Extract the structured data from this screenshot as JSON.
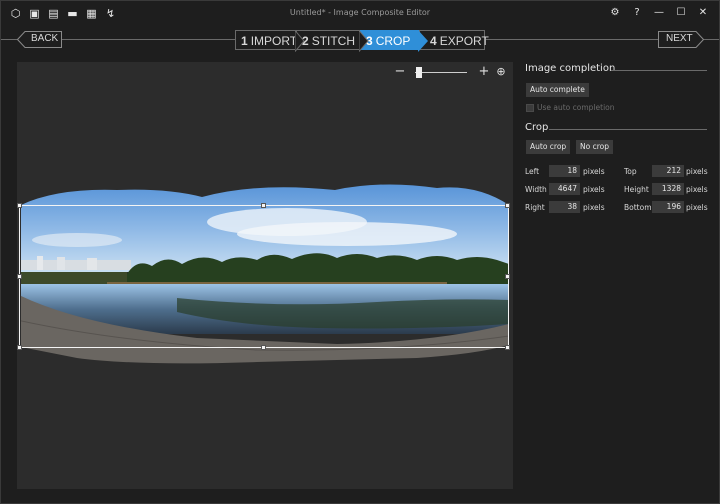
{
  "window": {
    "title": "Untitled* - Image Composite Editor",
    "toolbar_icons": [
      "new-panorama-icon",
      "new-from-images-icon",
      "new-from-video-icon",
      "open-icon",
      "save-icon",
      "publish-icon"
    ],
    "controls": [
      "settings-icon",
      "help-icon",
      "minimize-icon",
      "maximize-icon",
      "close-icon"
    ],
    "controls_glyphs": [
      "⚙",
      "?",
      "—",
      "☐",
      "✕"
    ]
  },
  "nav": {
    "back_label": "BACK",
    "next_label": "NEXT",
    "steps": [
      {
        "num": "1",
        "label": "IMPORT",
        "active": false
      },
      {
        "num": "2",
        "label": "STITCH",
        "active": false
      },
      {
        "num": "3",
        "label": "CROP",
        "active": true
      },
      {
        "num": "4",
        "label": "EXPORT",
        "active": false
      }
    ]
  },
  "zoom": {
    "level": 0.05
  },
  "panel": {
    "image_completion": {
      "title": "Image completion",
      "auto_complete_label": "Auto complete",
      "use_auto_completion_label": "Use auto completion",
      "use_auto_completion_checked": false
    },
    "crop": {
      "title": "Crop",
      "auto_crop_label": "Auto crop",
      "no_crop_label": "No crop",
      "unit": "pixels",
      "fields": {
        "left": {
          "label": "Left",
          "value": "18"
        },
        "top": {
          "label": "Top",
          "value": "212"
        },
        "width": {
          "label": "Width",
          "value": "4647"
        },
        "height": {
          "label": "Height",
          "value": "1328"
        },
        "right": {
          "label": "Right",
          "value": "38"
        },
        "bottom": {
          "label": "Bottom",
          "value": "196"
        }
      }
    }
  },
  "colors": {
    "accent": "#2f8fd8",
    "background": "#1e1e1e",
    "canvas": "#2c2c2c",
    "control": "#3b3b3b"
  }
}
